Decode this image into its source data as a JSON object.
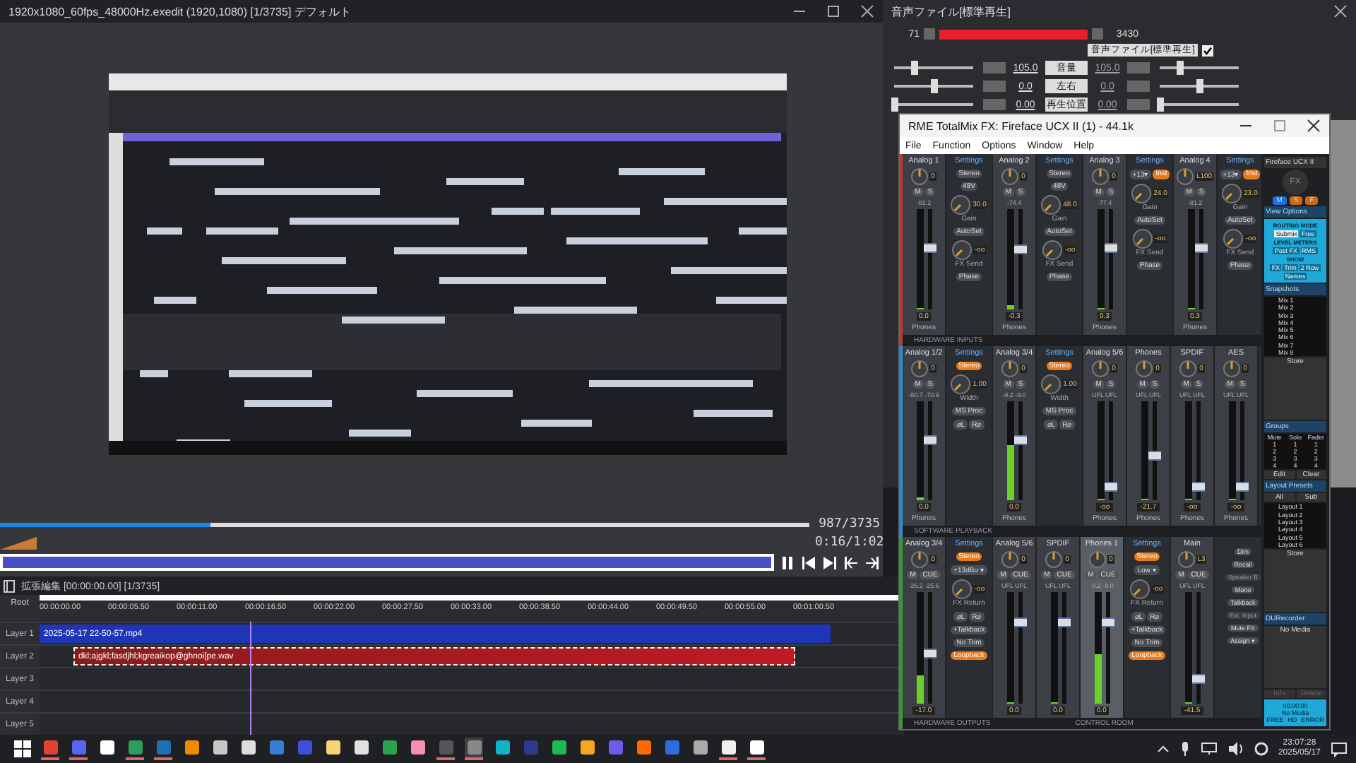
{
  "editor": {
    "title": "1920x1080_60fps_48000Hz.exedit (1920,1080)  [1/3735]  デフォルト",
    "frame_counter": "987/3735",
    "time": "0:16/1:02",
    "seek": {
      "level": 0.26
    }
  },
  "timeline": {
    "title": "拡張編集 [00:00:00.00] [1/3735]",
    "root": "Root",
    "ticks": [
      "00:00:00.00",
      "00:00:05.50",
      "00:00:11.00",
      "00:00:16.50",
      "00:00:22.00",
      "00:00:27.50",
      "00:00:33.00",
      "00:00:38.50",
      "00:00:44.00",
      "00:00:49.50",
      "00:00:55.00",
      "00:01:00.50"
    ],
    "layers": [
      {
        "label": "Layer 1",
        "clip": {
          "kind": "video",
          "name": "2025-05-17 22-50-57.mp4",
          "selected": false
        }
      },
      {
        "label": "Layer 2",
        "clip": {
          "kind": "audio",
          "name": "dkl;ajgkl;fasdjhl;kgreaikop@ghnoi[pe.wav",
          "selected": true
        }
      },
      {
        "label": "Layer 3"
      },
      {
        "label": "Layer 4"
      },
      {
        "label": "Layer 5"
      }
    ]
  },
  "audio_window": {
    "title": "音声ファイル[標準再生]",
    "start": "71",
    "end": "3430",
    "check_label": "音声ファイル[標準再生]",
    "checked": true,
    "params": [
      {
        "value": "105.0",
        "label": "音量",
        "value2": "105.0",
        "left": {
          "level": 0.25
        },
        "right": {
          "level": 0.25
        }
      },
      {
        "value": "0.0",
        "label": "左右",
        "value2": "0.0",
        "left": {
          "level": 0.5
        },
        "right": {
          "level": 0.5
        }
      },
      {
        "value": "0.00",
        "label": "再生位置",
        "value2": "0.00",
        "left": {
          "level": 0.0
        },
        "right": {
          "level": 0.0
        }
      }
    ]
  },
  "totalmix": {
    "title": "RME TotalMix FX: Fireface UCX II (1) - 44.1k",
    "menu": [
      "File",
      "Function",
      "Options",
      "Window",
      "Help"
    ],
    "rows": [
      {
        "labels": [
          "HARDWARE INPUTS"
        ],
        "items": [
          {
            "kind": "channel",
            "name": "Analog 1",
            "pan": "0",
            "buttons": [
              "M",
              "S"
            ],
            "peak": "-82.2",
            "meter": {
              "level": 0
            },
            "fader": {
              "level": 0.62
            },
            "value": "0.0",
            "bus": "Phones",
            "selected": false
          },
          {
            "kind": "settings",
            "title": "Settings",
            "controls": [
              {
                "kind": "buttons",
                "buttons": [
                  {
                    "label": "Stereo",
                    "on": false
                  }
                ]
              },
              {
                "kind": "buttons",
                "buttons": [
                  {
                    "label": "48V",
                    "on": false
                  }
                ]
              },
              {
                "kind": "knob",
                "value": "30.0",
                "label": "Gain"
              },
              {
                "kind": "buttons",
                "buttons": [
                  {
                    "label": "AutoSet",
                    "on": false
                  }
                ]
              },
              {
                "kind": "knob",
                "value": "-oo",
                "label": "FX Send"
              },
              {
                "kind": "buttons",
                "buttons": [
                  {
                    "label": "Phase",
                    "on": false
                  }
                ]
              }
            ]
          },
          {
            "kind": "channel",
            "name": "Analog 2",
            "pan": "0",
            "buttons": [
              "M",
              "S"
            ],
            "peak": "-74.4",
            "meter": {
              "level": 0.04
            },
            "fader": {
              "level": 0.6
            },
            "value": "-0.3",
            "bus": "Phones",
            "selected": false
          },
          {
            "kind": "settings",
            "title": "Settings",
            "controls": [
              {
                "kind": "buttons",
                "buttons": [
                  {
                    "label": "Stereo",
                    "on": false
                  }
                ]
              },
              {
                "kind": "buttons",
                "buttons": [
                  {
                    "label": "48V",
                    "on": false
                  }
                ]
              },
              {
                "kind": "knob",
                "value": "48.0",
                "label": "Gain"
              },
              {
                "kind": "buttons",
                "buttons": [
                  {
                    "label": "AutoSet",
                    "on": false
                  }
                ]
              },
              {
                "kind": "knob",
                "value": "-oo",
                "label": "FX Send"
              },
              {
                "kind": "buttons",
                "buttons": [
                  {
                    "label": "Phase",
                    "on": false
                  }
                ]
              }
            ]
          },
          {
            "kind": "channel",
            "name": "Analog 3",
            "pan": "0",
            "buttons": [
              "M",
              "S"
            ],
            "peak": "-77.4",
            "meter": {
              "level": 0
            },
            "fader": {
              "level": 0.62
            },
            "value": "0.3",
            "bus": "Phones",
            "selected": false
          },
          {
            "kind": "settings",
            "title": "Settings",
            "controls": [
              {
                "kind": "buttons",
                "buttons": [
                  {
                    "label": "+13▾",
                    "on": false
                  },
                  {
                    "label": "Inst",
                    "on": true
                  }
                ]
              },
              {
                "kind": "knob",
                "value": "24.0",
                "label": "Gain"
              },
              {
                "kind": "buttons",
                "buttons": [
                  {
                    "label": "AutoSet",
                    "on": false
                  }
                ]
              },
              {
                "kind": "knob",
                "value": "-oo",
                "label": "FX Send"
              },
              {
                "kind": "buttons",
                "buttons": [
                  {
                    "label": "Phase",
                    "on": false
                  }
                ]
              }
            ]
          },
          {
            "kind": "channel",
            "name": "Analog 4",
            "pan": "L100",
            "buttons": [
              "M",
              "S"
            ],
            "peak": "-81.2",
            "meter": {
              "level": 0
            },
            "fader": {
              "level": 0.62
            },
            "value": "0.3",
            "bus": "Phones",
            "selected": false
          },
          {
            "kind": "settings",
            "title": "Settings",
            "controls": [
              {
                "kind": "buttons",
                "buttons": [
                  {
                    "label": "+13▾",
                    "on": false
                  },
                  {
                    "label": "Inst",
                    "on": true
                  }
                ]
              },
              {
                "kind": "knob",
                "value": "23.0",
                "label": "Gain"
              },
              {
                "kind": "buttons",
                "buttons": [
                  {
                    "label": "AutoSet",
                    "on": false
                  }
                ]
              },
              {
                "kind": "knob",
                "value": "-oo",
                "label": "FX Send"
              },
              {
                "kind": "buttons",
                "buttons": [
                  {
                    "label": "Phase",
                    "on": false
                  }
                ]
              }
            ]
          }
        ]
      },
      {
        "labels": [
          "SOFTWARE PLAYBACK"
        ],
        "items": [
          {
            "kind": "channel",
            "name": "Analog 1/2",
            "pan": "0",
            "buttons": [
              "M",
              "S"
            ],
            "peak": "-80.7 -70.9",
            "meter": {
              "level": 0.03
            },
            "fader": {
              "level": 0.62
            },
            "value": "0.0",
            "bus": "Phones",
            "selected": false
          },
          {
            "kind": "settings",
            "title": "Settings",
            "controls": [
              {
                "kind": "buttons",
                "buttons": [
                  {
                    "label": "Stereo",
                    "on": true
                  }
                ]
              },
              {
                "kind": "knob",
                "value": "1.00",
                "label": "Width"
              },
              {
                "kind": "buttons",
                "buttons": [
                  {
                    "label": "MS Proc",
                    "on": false
                  }
                ]
              },
              {
                "kind": "buttons",
                "buttons": [
                  {
                    "label": "⌀L",
                    "on": false
                  },
                  {
                    "label": "R⌀",
                    "on": false
                  }
                ]
              }
            ]
          },
          {
            "kind": "channel",
            "name": "Analog 3/4",
            "pan": "0",
            "buttons": [
              "M",
              "S"
            ],
            "peak": "-9.2 -9.0",
            "meter": {
              "level": 0.55
            },
            "fader": {
              "level": 0.62
            },
            "value": "0.0",
            "bus": "Phones",
            "selected": false
          },
          {
            "kind": "settings",
            "title": "Settings",
            "controls": [
              {
                "kind": "buttons",
                "buttons": [
                  {
                    "label": "Stereo",
                    "on": true
                  }
                ]
              },
              {
                "kind": "knob",
                "value": "1.00",
                "label": "Width"
              },
              {
                "kind": "buttons",
                "buttons": [
                  {
                    "label": "MS Proc",
                    "on": false
                  }
                ]
              },
              {
                "kind": "buttons",
                "buttons": [
                  {
                    "label": "⌀L",
                    "on": false
                  },
                  {
                    "label": "R⌀",
                    "on": false
                  }
                ]
              }
            ]
          },
          {
            "kind": "channel",
            "name": "Analog 5/6",
            "pan": "0",
            "buttons": [
              "M",
              "S"
            ],
            "peak": "UFL UFL",
            "meter": {
              "level": 0
            },
            "fader": {
              "level": 0.1
            },
            "value": "-oo",
            "bus": "Phones",
            "selected": false
          },
          {
            "kind": "channel",
            "name": "Phones",
            "pan": "0",
            "buttons": [
              "M",
              "S"
            ],
            "peak": "UFL UFL",
            "meter": {
              "level": 0
            },
            "fader": {
              "level": 0.45
            },
            "value": "-21.7",
            "bus": "Phones",
            "selected": false
          },
          {
            "kind": "channel",
            "name": "SPDIF",
            "pan": "0",
            "buttons": [
              "M",
              "S"
            ],
            "peak": "UFL UFL",
            "meter": {
              "level": 0
            },
            "fader": {
              "level": 0.1
            },
            "value": "-oo",
            "bus": "Phones",
            "selected": false
          },
          {
            "kind": "channel",
            "name": "AES",
            "pan": "0",
            "buttons": [
              "M",
              "S"
            ],
            "peak": "UFL UFL",
            "meter": {
              "level": 0
            },
            "fader": {
              "level": 0.1
            },
            "value": "-oo",
            "bus": "Phones",
            "selected": false
          }
        ]
      },
      {
        "labels": [
          "HARDWARE OUTPUTS",
          "CONTROL ROOM"
        ],
        "items": [
          {
            "kind": "channel",
            "name": "Analog 3/4",
            "pan": "0",
            "buttons": [
              "M",
              "CUE"
            ],
            "peak": "-26.2 -25.6",
            "meter": {
              "level": 0.25
            },
            "fader": {
              "level": 0.45
            },
            "value": "-17.0",
            "selected": false
          },
          {
            "kind": "settings",
            "title": "Settings",
            "controls": [
              {
                "kind": "buttons",
                "buttons": [
                  {
                    "label": "Stereo",
                    "on": true
                  }
                ]
              },
              {
                "kind": "buttons",
                "buttons": [
                  {
                    "label": "+13dBu ▾",
                    "on": false
                  }
                ]
              },
              {
                "kind": "knob",
                "value": "-oo",
                "label": "FX Return"
              },
              {
                "kind": "buttons",
                "buttons": [
                  {
                    "label": "⌀L",
                    "on": false
                  },
                  {
                    "label": "R⌀",
                    "on": false
                  }
                ]
              },
              {
                "kind": "buttons",
                "buttons": [
                  {
                    "label": "+Talkback",
                    "on": false
                  }
                ]
              },
              {
                "kind": "buttons",
                "buttons": [
                  {
                    "label": "No Trim",
                    "on": false
                  }
                ]
              },
              {
                "kind": "buttons",
                "buttons": [
                  {
                    "label": "Loopback",
                    "on": true
                  }
                ]
              }
            ]
          },
          {
            "kind": "channel",
            "name": "Analog 5/6",
            "pan": "0",
            "buttons": [
              "M",
              "CUE"
            ],
            "peak": "UFL UFL",
            "meter": {
              "level": 0
            },
            "fader": {
              "level": 0.75
            },
            "value": "0.0",
            "selected": false
          },
          {
            "kind": "channel",
            "name": "SPDIF",
            "pan": "0",
            "buttons": [
              "M",
              "CUE"
            ],
            "peak": "UFL UFL",
            "meter": {
              "level": 0
            },
            "fader": {
              "level": 0.75
            },
            "value": "0.0",
            "selected": false
          },
          {
            "kind": "channel",
            "name": "Phones 1",
            "pan": "0",
            "buttons": [
              "M",
              "CUE"
            ],
            "peak": "-9.2 -9.0",
            "meter": {
              "level": 0.45
            },
            "fader": {
              "level": 0.75
            },
            "value": "0.0",
            "selected": true
          },
          {
            "kind": "settings",
            "title": "Settings",
            "controls": [
              {
                "kind": "buttons",
                "buttons": [
                  {
                    "label": "Stereo",
                    "on": true
                  }
                ]
              },
              {
                "kind": "buttons",
                "buttons": [
                  {
                    "label": "Low ▾",
                    "on": false
                  }
                ]
              },
              {
                "kind": "knob",
                "value": "-oo",
                "label": "FX Return"
              },
              {
                "kind": "buttons",
                "buttons": [
                  {
                    "label": "⌀L",
                    "on": false
                  },
                  {
                    "label": "R⌀",
                    "on": false
                  }
                ]
              },
              {
                "kind": "buttons",
                "buttons": [
                  {
                    "label": "+Talkback",
                    "on": false
                  }
                ]
              },
              {
                "kind": "buttons",
                "buttons": [
                  {
                    "label": "No Trim",
                    "on": false
                  }
                ]
              },
              {
                "kind": "buttons",
                "buttons": [
                  {
                    "label": "Loopback",
                    "on": true
                  }
                ]
              }
            ]
          },
          {
            "kind": "channel",
            "name": "Main",
            "pan": "L3",
            "buttons": [
              "M",
              "CUE"
            ],
            "peak": "UFL UFL",
            "meter": {
              "level": 0
            },
            "fader": {
              "level": 0.2
            },
            "value": "-41.5",
            "selected": false
          },
          {
            "kind": "controlroom",
            "buttons": [
              {
                "label": "Dim",
                "disabled": false
              },
              {
                "label": "Recall",
                "disabled": false
              },
              {
                "label": "Speaker B",
                "disabled": true
              },
              {
                "label": "Mono",
                "disabled": false
              },
              {
                "label": "Talkback",
                "disabled": false
              },
              {
                "label": "Ext. Input",
                "disabled": true
              },
              {
                "label": "Mute FX",
                "disabled": false
              },
              {
                "label": "Assign ▾",
                "disabled": false
              }
            ]
          }
        ]
      }
    ],
    "sidebar": {
      "device": "Fireface UCX II",
      "fx": "FX",
      "modes": [
        {
          "label": "M",
          "selected": true
        },
        {
          "label": "S",
          "selected": false
        },
        {
          "label": "F",
          "selected": false
        }
      ],
      "view_options": {
        "title": "View Options",
        "groups": [
          {
            "title": "ROUTING MODE",
            "buttons": [
              {
                "label": "Submix",
                "selected": true
              },
              {
                "label": "Free",
                "selected": false
              }
            ]
          },
          {
            "title": "LEVEL METERS",
            "buttons": [
              {
                "label": "Post FX",
                "selected": false
              },
              {
                "label": "RMS",
                "selected": false
              }
            ]
          },
          {
            "title": "SHOW",
            "buttons": [
              {
                "label": "FX",
                "selected": false
              },
              {
                "label": "Trim",
                "selected": false
              },
              {
                "label": "2 Row",
                "selected": false
              },
              {
                "label": "Names",
                "selected": false
              }
            ]
          }
        ]
      },
      "snapshots": {
        "title": "Snapshots",
        "items": [
          "Mix 1",
          "Mix 2",
          "Mix 3",
          "Mix 4",
          "Mix 5",
          "Mix 6",
          "Mix 7",
          "Mix 8"
        ],
        "store": "Store"
      },
      "groups": {
        "title": "Groups",
        "columns": [
          "Mute",
          "Solo",
          "Fader"
        ],
        "rows": [
          [
            "1",
            "1",
            "1"
          ],
          [
            "2",
            "2",
            "2"
          ],
          [
            "3",
            "3",
            "3"
          ],
          [
            "4",
            "4",
            "4"
          ]
        ],
        "edit": "Edit",
        "clear": "Clear"
      },
      "layouts": {
        "title": "Layout Presets",
        "tabs": [
          "All",
          "Sub"
        ],
        "items": [
          "Layout 1",
          "Layout 2",
          "Layout 3",
          "Layout 4",
          "Layout 5",
          "Layout 6"
        ],
        "store": "Store"
      },
      "recorder": {
        "title": "DURecorder",
        "media": "No Media",
        "info": "Info",
        "delete": "Delete",
        "time": "00:00:00",
        "status": "No Media",
        "flags": [
          "FREE",
          "HD",
          "ERROR"
        ]
      }
    }
  },
  "taskbar": {
    "apps": [
      {
        "running": true,
        "selected": false
      },
      {
        "running": true,
        "selected": false
      },
      {
        "running": false,
        "selected": false
      },
      {
        "running": true,
        "selected": false
      },
      {
        "running": true,
        "selected": false
      },
      {
        "running": false,
        "selected": false
      },
      {
        "running": false,
        "selected": false
      },
      {
        "running": false,
        "selected": false
      },
      {
        "running": false,
        "selected": false
      },
      {
        "running": false,
        "selected": false
      },
      {
        "running": false,
        "selected": false
      },
      {
        "running": false,
        "selected": false
      },
      {
        "running": false,
        "selected": false
      },
      {
        "running": false,
        "selected": false
      },
      {
        "running": true,
        "selected": false
      },
      {
        "running": true,
        "selected": true
      },
      {
        "running": false,
        "selected": false
      },
      {
        "running": false,
        "selected": false
      },
      {
        "running": false,
        "selected": false
      },
      {
        "running": false,
        "selected": false
      },
      {
        "running": false,
        "selected": false
      },
      {
        "running": false,
        "selected": false
      },
      {
        "running": false,
        "selected": false
      },
      {
        "running": false,
        "selected": false
      },
      {
        "running": true,
        "selected": false
      },
      {
        "running": true,
        "selected": false
      }
    ],
    "time": "23:07:28",
    "date": "2025/05/17"
  }
}
